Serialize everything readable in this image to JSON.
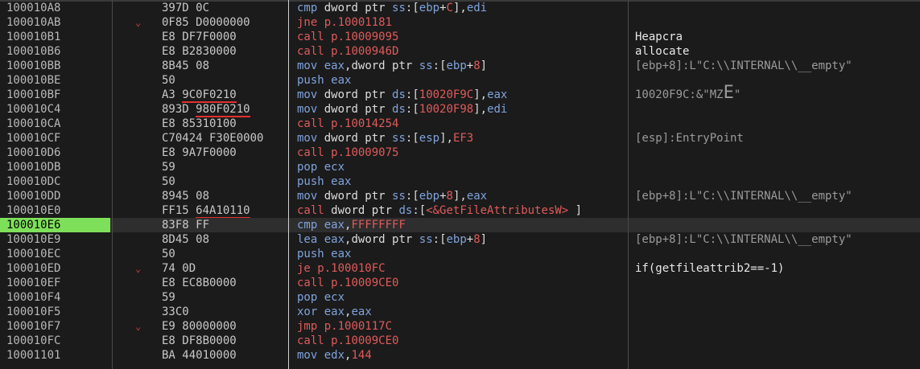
{
  "rows": [
    {
      "addr": "100010A8",
      "arrow": "",
      "bytes": "397D 0C",
      "ul": "",
      "ins": "cmp dword ptr ss:[ebp+C],edi",
      "comment": "",
      "cclass": ""
    },
    {
      "addr": "100010AB",
      "arrow": "⌄",
      "bytes": "0F85 D0000000",
      "ul": "",
      "ins": "jne p.10001181",
      "comment": "",
      "cclass": ""
    },
    {
      "addr": "100010B1",
      "arrow": "",
      "bytes": "E8 DF7F0000",
      "ul": "",
      "ins": "call p.10009095",
      "comment": "Heapcra",
      "cclass": "white"
    },
    {
      "addr": "100010B6",
      "arrow": "",
      "bytes": "E8 B2830000",
      "ul": "",
      "ins": "call p.1000946D",
      "comment": "allocate",
      "cclass": "white"
    },
    {
      "addr": "100010BB",
      "arrow": "",
      "bytes": "8B45 08",
      "ul": "",
      "ins": "mov eax,dword ptr ss:[ebp+8]",
      "comment": "[ebp+8]:L\"C:\\\\INTERNAL\\\\__empty\"",
      "cclass": ""
    },
    {
      "addr": "100010BE",
      "arrow": "",
      "bytes": "50",
      "ul": "",
      "ins": "push eax",
      "comment": "",
      "cclass": ""
    },
    {
      "addr": "100010BF",
      "arrow": "",
      "bytes": "A3 ",
      "ul": "9C0F0210",
      "ins": "mov dword ptr ds:[10020F9C],eax",
      "comment": "10020F9C:&\"MZ",
      "big": "E",
      "comment2": "\"",
      "cclass": ""
    },
    {
      "addr": "100010C4",
      "arrow": "",
      "bytes": "893D ",
      "ul": "980F0210",
      "ins": "mov dword ptr ds:[10020F98],edi",
      "comment": "",
      "cclass": ""
    },
    {
      "addr": "100010CA",
      "arrow": "",
      "bytes": "E8 85310100",
      "ul": "",
      "ins": "call p.10014254",
      "comment": "",
      "cclass": ""
    },
    {
      "addr": "100010CF",
      "arrow": "",
      "bytes": "C70424 F30E0000",
      "ul": "",
      "ins": "mov dword ptr ss:[esp],EF3",
      "comment": "[esp]:EntryPoint",
      "cclass": ""
    },
    {
      "addr": "100010D6",
      "arrow": "",
      "bytes": "E8 9A7F0000",
      "ul": "",
      "ins": "call p.10009075",
      "comment": "",
      "cclass": ""
    },
    {
      "addr": "100010DB",
      "arrow": "",
      "bytes": "59",
      "ul": "",
      "ins": "pop ecx",
      "comment": "",
      "cclass": ""
    },
    {
      "addr": "100010DC",
      "arrow": "",
      "bytes": "50",
      "ul": "",
      "ins": "push eax",
      "comment": "",
      "cclass": ""
    },
    {
      "addr": "100010DD",
      "arrow": "",
      "bytes": "8945 08",
      "ul": "",
      "ins": "mov dword ptr ss:[ebp+8],eax",
      "comment": "[ebp+8]:L\"C:\\\\INTERNAL\\\\__empty\"",
      "cclass": ""
    },
    {
      "addr": "100010E0",
      "arrow": "",
      "bytes": "FF15 ",
      "ul": "64A10110",
      "ins": "call dword ptr ds:[<&GetFileAttributesW> ]",
      "comment": "",
      "cclass": ""
    },
    {
      "addr": "100010E6",
      "arrow": "",
      "bytes": "83F8 FF",
      "ul": "",
      "ins": "cmp eax,FFFFFFFF",
      "comment": "",
      "cclass": "",
      "selected": true
    },
    {
      "addr": "100010E9",
      "arrow": "",
      "bytes": "8D45 08",
      "ul": "",
      "ins": "lea eax,dword ptr ss:[ebp+8]",
      "comment": "[ebp+8]:L\"C:\\\\INTERNAL\\\\__empty\"",
      "cclass": ""
    },
    {
      "addr": "100010EC",
      "arrow": "",
      "bytes": "50",
      "ul": "",
      "ins": "push eax",
      "comment": "",
      "cclass": ""
    },
    {
      "addr": "100010ED",
      "arrow": "⌄",
      "bytes": "74 0D",
      "ul": "",
      "ins": "je p.100010FC",
      "comment": "if(getfileattrib2==-1)",
      "cclass": "white"
    },
    {
      "addr": "100010EF",
      "arrow": "",
      "bytes": "E8 EC8B0000",
      "ul": "",
      "ins": "call p.10009CE0",
      "comment": "",
      "cclass": ""
    },
    {
      "addr": "100010F4",
      "arrow": "",
      "bytes": "59",
      "ul": "",
      "ins": "pop ecx",
      "comment": "",
      "cclass": ""
    },
    {
      "addr": "100010F5",
      "arrow": "",
      "bytes": "33C0",
      "ul": "",
      "ins": "xor eax,eax",
      "comment": "",
      "cclass": ""
    },
    {
      "addr": "100010F7",
      "arrow": "⌄",
      "bytes": "E9 80000000",
      "ul": "",
      "ins": "jmp p.1000117C",
      "comment": "",
      "cclass": ""
    },
    {
      "addr": "100010FC",
      "arrow": "",
      "bytes": "E8 DF8B0000",
      "ul": "",
      "ins": "call p.10009CE0",
      "comment": "",
      "cclass": ""
    },
    {
      "addr": "10001101",
      "arrow": "",
      "bytes": "BA 44010000",
      "ul": "",
      "ins": "mov edx,144",
      "comment": "",
      "cclass": ""
    }
  ],
  "colors": {
    "keyword": "#7fa3dc",
    "register": "#7fa3dc",
    "memref": "#e05a5a",
    "call": "#e05a5a",
    "jump": "#e05a5a",
    "pushpop": "#7fa3dc",
    "selected_addr_bg": "#7ee05a"
  }
}
